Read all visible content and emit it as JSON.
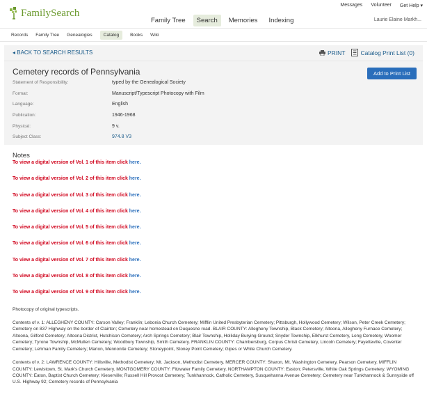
{
  "top_links": [
    "Messages",
    "Volunteer",
    "Get Help ▾"
  ],
  "logo_text": "FamilySearch",
  "main_nav": [
    {
      "label": "Family Tree",
      "active": false
    },
    {
      "label": "Search",
      "active": true
    },
    {
      "label": "Memories",
      "active": false
    },
    {
      "label": "Indexing",
      "active": false
    }
  ],
  "user_name": "Laurie Elaine Markh...",
  "sub_nav": [
    {
      "label": "Records",
      "active": false
    },
    {
      "label": "Family Tree",
      "active": false
    },
    {
      "label": "Genealogies",
      "active": false
    },
    {
      "label": "Catalog",
      "active": true
    },
    {
      "label": "Books",
      "active": false
    },
    {
      "label": "Wiki",
      "active": false
    }
  ],
  "back_link": "◂ BACK TO SEARCH RESULTS",
  "print_label": "PRINT",
  "catalog_print_list": "Catalog Print List (0)",
  "record": {
    "title": "Cemetery records of Pennsylvania",
    "add_button": "Add to Print List",
    "fields": [
      {
        "label": "Statement of Responsibility:",
        "value": "typed by the Genealogical Society",
        "link": false
      },
      {
        "label": "Format:",
        "value": "Manuscript/Typescript Photocopy with Film",
        "link": false
      },
      {
        "label": "Language:",
        "value": "English",
        "link": false
      },
      {
        "label": "Publication:",
        "value": "1946-1968",
        "link": false
      },
      {
        "label": "Physical:",
        "value": "9 v.",
        "link": false
      },
      {
        "label": "Subject Class:",
        "value": "974.8 V3",
        "link": true
      }
    ]
  },
  "notes": {
    "title": "Notes",
    "here_text": "here.",
    "volume_lines": [
      "To view a digital version of Vol. 1 of this item click ",
      "To view a digital version of Vol. 2 of this item click ",
      "To view a digital version of Vol. 3 of this item click ",
      "To view a digital version of Vol. 4 of this item click ",
      "To view a digital version of Vol. 5 of this item click ",
      "To view a digital version of Vol. 6 of this item click ",
      "To view a digital version of Vol. 7 of this item click ",
      "To view a digital version of Vol. 8 of this item click ",
      "To view a digital version of Vol. 9 of this item click "
    ],
    "photocopy": "Photocopy of original typescripts.",
    "contents_v1": "Contents of v. 1: ALLEGHENY COUNTY: Carson Valley; Franklin; Lebonia Church Cemetery; Mifflin United Presbyterian Cemetery; Pittsburgh, Hollywood Cemetery; Wilson, Peter Creek Cemetery; Cemetery on 837 Highway on the border of Clairton; Cemetery near homestead on Duquesne road. BLAIR COUNTY: Allegheny Township, Black Cemetery; Altoona, Allegheny Furnace Cemetery; Altoona, Gilford Cemetery; Altoona District, Hutchison Cemetery; Arch Springs Cemetery; Blair Township, Holliday Burying Ground; Snyder Township, Elkhurst Cemetery, Long Cemetery, Woomer Cemetery; Tyrone Township, McMullen Cemetery; Woodbury Township, Smith Cemetery. FRANKLIN COUNTY: Chambersburg, Corpus Christi Cemetery, Lincoln Cemetery; Fayetteville, Coventer Cemetery; Lehman Family Cemetery; Marion, Mennonite Cemetery; Stoneypoint, Stoney Point Cemetery; Gipes or White Church Cemetery.",
    "contents_v2": "Contents of v. 2: LAWRENCE COUNTY: Hillsville, Methodist Cemetery; Mt. Jackson, Methodist Cemetery. MERCER COUNTY: Sharon, Mt. Washington Cemetery, Pearson Cemetery. MIFFLIN COUNTY: Lewistown, St. Mark's Church Cemetery. MONTGOMERY COUNTY: Fitzwater Family Cemetery. NORTHAMPTON COUNTY: Easton; Petersville, White Oak Springs Cemetery. WYOMING COUNTY: Eaton, Baptist Church Cemetery; Kieserville; Russell Hill Provost Cemetery; Tunkhannock, Catholic Cemetery, Susquehanna Avenue Cemetery; Cemetery near Tunkhannock & Sunnyside off U.S. Highway 92; Cemetery records of Pennsylvania"
  }
}
